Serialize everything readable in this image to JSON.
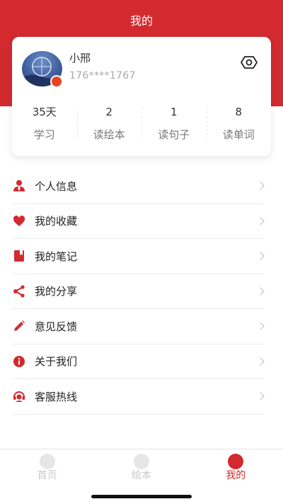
{
  "header": {
    "title": "我的"
  },
  "profile": {
    "name": "小邢",
    "phone": "176****1767"
  },
  "stats": [
    {
      "value": "35天",
      "label": "学习"
    },
    {
      "value": "2",
      "label": "读绘本"
    },
    {
      "value": "1",
      "label": "读句子"
    },
    {
      "value": "8",
      "label": "读单词"
    }
  ],
  "menu": [
    {
      "label": "个人信息",
      "icon": "user-icon"
    },
    {
      "label": "我的收藏",
      "icon": "heart-icon"
    },
    {
      "label": "我的笔记",
      "icon": "notebook-icon"
    },
    {
      "label": "我的分享",
      "icon": "share-icon"
    },
    {
      "label": "意见反馈",
      "icon": "pencil-icon"
    },
    {
      "label": "关于我们",
      "icon": "info-icon"
    },
    {
      "label": "客服热线",
      "icon": "headset-icon"
    }
  ],
  "tabs": [
    {
      "label": "首页",
      "icon": "home-icon",
      "active": false
    },
    {
      "label": "绘本",
      "icon": "book-icon",
      "active": false
    },
    {
      "label": "我的",
      "icon": "profile-icon",
      "active": true
    }
  ],
  "colors": {
    "brand": "#d22a2f",
    "muted": "#aaaaaa"
  }
}
